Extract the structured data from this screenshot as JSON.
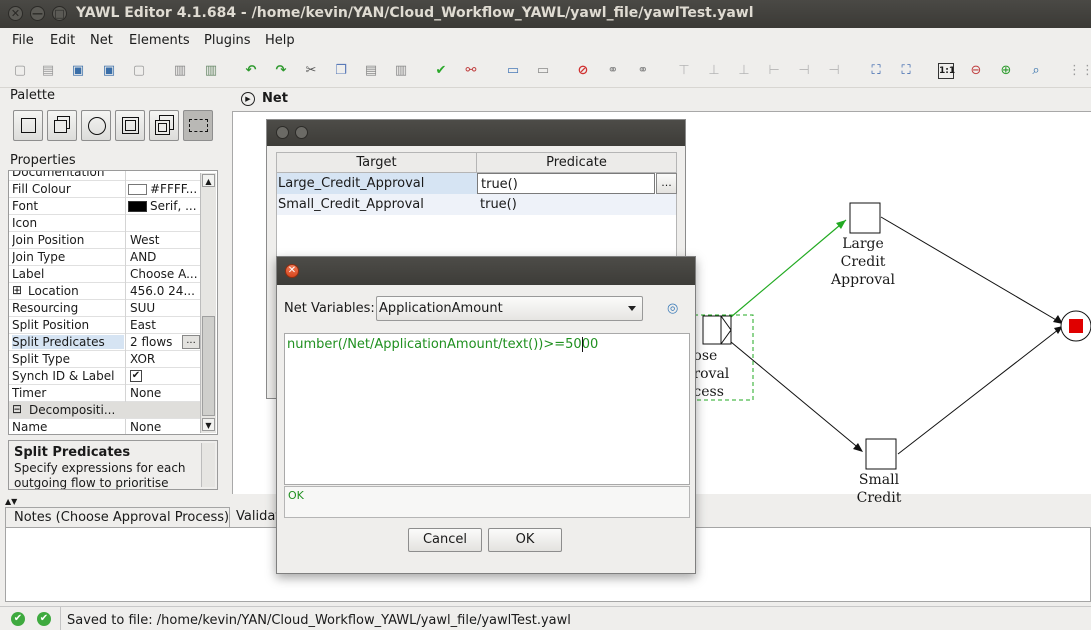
{
  "window": {
    "title": "YAWL Editor 4.1.684 - /home/kevin/YAN/Cloud_Workflow_YAWL/yawl_file/yawlTest.yawl",
    "close_glyph": "✕",
    "minimize_glyph": "—",
    "maximize_glyph": "□"
  },
  "menu": [
    "File",
    "Edit",
    "Net",
    "Elements",
    "Plugins",
    "Help"
  ],
  "palette": {
    "title": "Palette"
  },
  "properties": {
    "title": "Properties",
    "rows": [
      {
        "key": "Documentation",
        "value": ""
      },
      {
        "key": "Fill Colour",
        "value": "#FFFF..."
      },
      {
        "key": "Font",
        "value": "Serif, ..."
      },
      {
        "key": "Icon",
        "value": ""
      },
      {
        "key": "Join Position",
        "value": "West"
      },
      {
        "key": "Join Type",
        "value": "AND"
      },
      {
        "key": "Label",
        "value": "Choose A..."
      },
      {
        "key": "Location",
        "value": "456.0 24..."
      },
      {
        "key": "Resourcing",
        "value": "SUU"
      },
      {
        "key": "Split Position",
        "value": "East"
      },
      {
        "key": "Split Predicates",
        "value": "2 flows"
      },
      {
        "key": "Split Type",
        "value": "XOR"
      },
      {
        "key": "Synch ID & Label",
        "value": ""
      },
      {
        "key": "Timer",
        "value": "None"
      },
      {
        "key": "Decompositi...",
        "value": ""
      },
      {
        "key": "Name",
        "value": "None"
      }
    ],
    "expand_glyph": "⊞",
    "collapse_glyph": "⊟",
    "checkbox_glyph": "✔",
    "more_button": "..."
  },
  "description": {
    "title": "Split Predicates",
    "text": "Specify expressions for each outgoing flow to prioritise"
  },
  "net_tab": {
    "label": "Net",
    "play_glyph": "▶"
  },
  "canvas": {
    "task_large": [
      "Large",
      "Credit",
      "Approval"
    ],
    "task_small": [
      "Small",
      "Credit"
    ],
    "task_choose": [
      "oose",
      "oroval",
      "ocess"
    ]
  },
  "notes": {
    "tab_label": "Notes (Choose Approval Process)",
    "validation_tab": "Validat"
  },
  "status": {
    "text": "Saved to file: /home/kevin/YAN/Cloud_Workflow_YAWL/yawl_file/yawlTest.yawl"
  },
  "predicate_dialog": {
    "columns": [
      "Target",
      "Predicate"
    ],
    "rows": [
      {
        "target": "Large_Credit_Approval",
        "predicate": "true()"
      },
      {
        "target": "Small_Credit_Approval",
        "predicate": "true()"
      }
    ],
    "edit_button": "..."
  },
  "expression_dialog": {
    "net_variables_label": "Net Variables:",
    "selected_variable": "ApplicationAmount",
    "expression": "number(/Net/ApplicationAmount/text())>=5000",
    "result": "OK",
    "cancel_label": "Cancel",
    "ok_label": "OK",
    "close_glyph": "✕",
    "insert_glyph": "◎"
  },
  "colors": {
    "titlebar": "#3d3c38",
    "expression_text": "#209020",
    "selected_flow": "#22aa22",
    "end_condition": "#e00000"
  }
}
